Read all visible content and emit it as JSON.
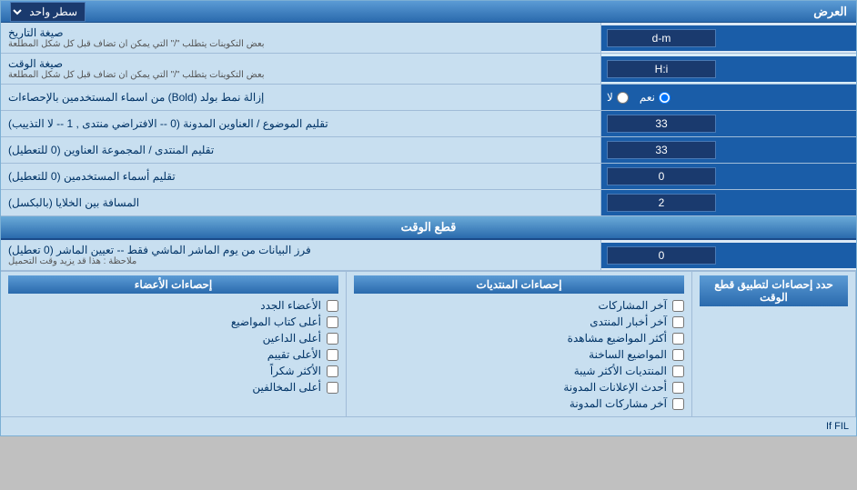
{
  "header": {
    "label": "العرض",
    "dropdown_label": "سطر واحد"
  },
  "rows": [
    {
      "id": "date-format",
      "label": "صيغة التاريخ",
      "sublabel": "بعض التكوينات يتطلب \"/\" التي يمكن ان تضاف قبل كل شكل المطلعة",
      "value": "d-m",
      "type": "input"
    },
    {
      "id": "time-format",
      "label": "صيغة الوقت",
      "sublabel": "بعض التكوينات يتطلب \"/\" التي يمكن ان تضاف قبل كل شكل المطلعة",
      "value": "H:i",
      "type": "input"
    },
    {
      "id": "bold-remove",
      "label": "إزالة نمط بولد (Bold) من اسماء المستخدمين بالإحصاءات",
      "type": "radio",
      "options": [
        "نعم",
        "لا"
      ],
      "selected": "نعم"
    },
    {
      "id": "topic-order",
      "label": "تقليم الموضوع / العناوين المدونة (0 -- الافتراضي منتدى , 1 -- لا التذييب)",
      "value": "33",
      "type": "input"
    },
    {
      "id": "forum-order",
      "label": "تقليم المنتدى / المجموعة العناوين (0 للتعطيل)",
      "value": "33",
      "type": "input"
    },
    {
      "id": "user-names",
      "label": "تقليم أسماء المستخدمين (0 للتعطيل)",
      "value": "0",
      "type": "input"
    },
    {
      "id": "gap-cells",
      "label": "المسافة بين الخلايا (بالبكسل)",
      "value": "2",
      "type": "input"
    }
  ],
  "section_cutoff": {
    "title": "قطع الوقت",
    "row": {
      "label": "فرز البيانات من يوم الماشر الماشي فقط -- تعيين الماشر (0 تعطيل)",
      "note": "ملاحظة : هذا قد يزيد وقت التحميل",
      "value": "0"
    }
  },
  "stats": {
    "left_panel": {
      "header": "حدد إحصاءات لتطبيق قطع الوقت"
    },
    "col1": {
      "header": "إحصاءات المنتديات",
      "items": [
        "آخر المشاركات",
        "آخر أخبار المنتدى",
        "أكثر المواضيع مشاهدة",
        "المواضيع الساخنة",
        "المنتديات الأكثر شيبة",
        "أحدث الإعلانات المدونة",
        "آخر مشاركات المدونة"
      ]
    },
    "col2": {
      "header": "إحصاءات الأعضاء",
      "items": [
        "الأعضاء الجدد",
        "أعلى كتاب المواضيع",
        "أعلى الداعين",
        "الأعلى تقييم",
        "الأكثر شكراً",
        "أعلى المخالفين"
      ]
    }
  }
}
